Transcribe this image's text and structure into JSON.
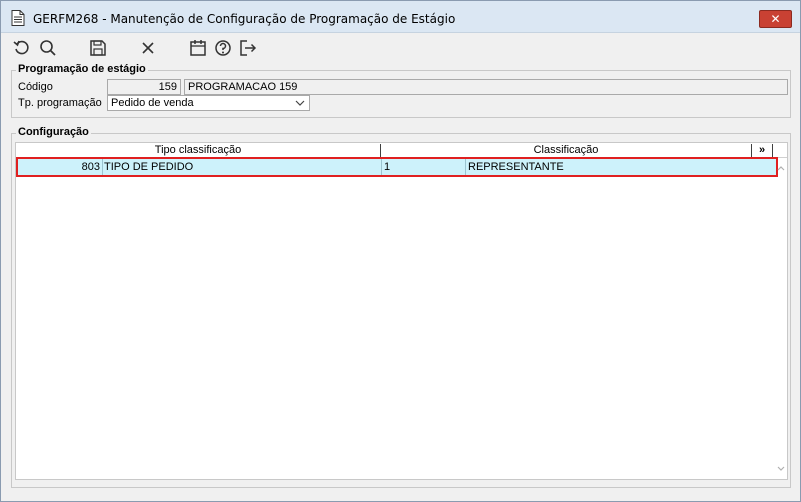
{
  "window": {
    "title": "GERFM268 - Manutenção de Configuração de Programação de Estágio",
    "close_label": "✕"
  },
  "toolbar": {
    "buttons": [
      {
        "icon": "undo-icon"
      },
      {
        "icon": "search-icon"
      },
      {
        "icon": "save-icon"
      },
      {
        "icon": "cancel-icon"
      },
      {
        "icon": "calendar-icon"
      },
      {
        "icon": "help-icon"
      },
      {
        "icon": "exit-icon"
      }
    ]
  },
  "programacao": {
    "group_title": "Programação de estágio",
    "codigo_label": "Código",
    "codigo_value": "159",
    "descricao_value": "PROGRAMACAO 159",
    "tipo_label": "Tp. programação",
    "tipo_value": "Pedido de venda"
  },
  "configuracao": {
    "group_title": "Configuração",
    "columns": [
      "Tipo classificação",
      "Classificação"
    ],
    "more_label": "»",
    "rows": [
      {
        "tipo_code": "803",
        "tipo_desc": "TIPO DE PEDIDO",
        "class_code": "1",
        "class_desc": "REPRESENTANTE"
      }
    ]
  },
  "colors": {
    "selected_row": "#cdf2fb",
    "highlight_outline": "#e02020",
    "close_button": "#c94133"
  }
}
